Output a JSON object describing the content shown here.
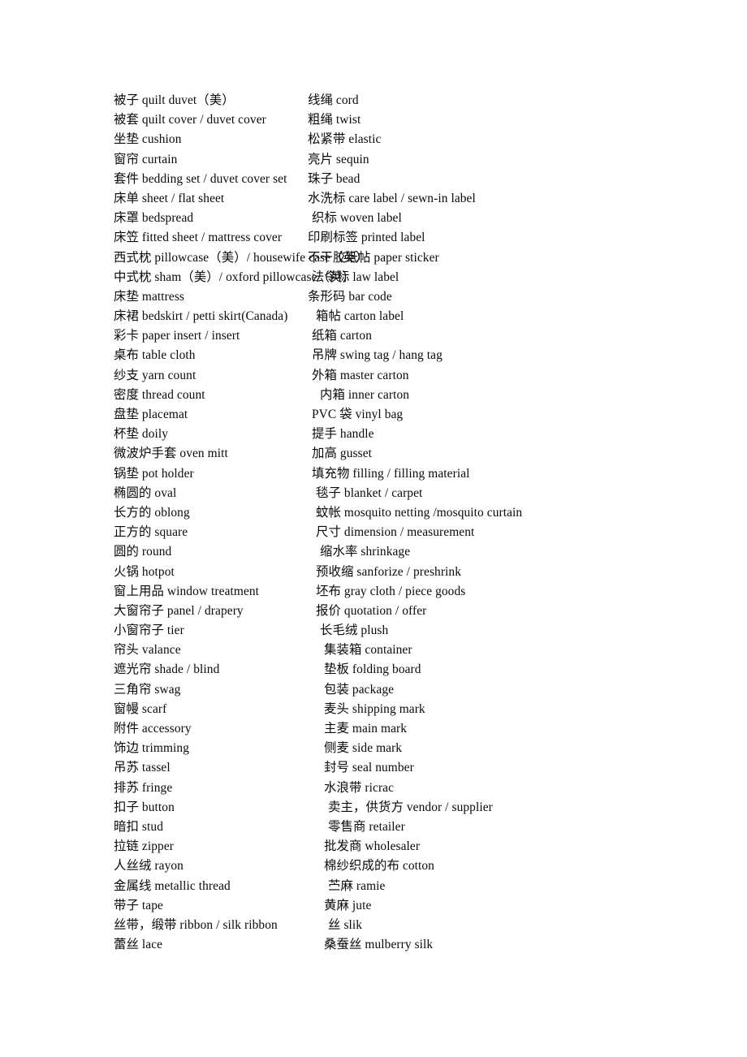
{
  "document": {
    "type": "bilingual-glossary",
    "background_color": "#ffffff",
    "text_color": "#000000"
  },
  "left_column": {
    "entries": [
      {
        "text": "被子 quilt duvet（美）",
        "indent": 0
      },
      {
        "text": "被套 quilt cover / duvet cover",
        "indent": 0
      },
      {
        "text": "坐垫  cushion",
        "indent": 0
      },
      {
        "text": "窗帘 curtain",
        "indent": 0
      },
      {
        "text": "套件 bedding set / duvet cover set",
        "indent": 0
      },
      {
        "text": "床单 sheet / flat sheet",
        "indent": 0
      },
      {
        "text": "床罩 bedspread",
        "indent": 0
      },
      {
        "text": "床笠 fitted sheet / mattress cover",
        "indent": 0
      },
      {
        "text": "西式枕 pillowcase（美）/ housewife case（英）",
        "indent": 0
      },
      {
        "text": "中式枕  sham（美）/ oxford pillowcase（英）",
        "indent": 0
      },
      {
        "text": "床垫  mattress",
        "indent": 0
      },
      {
        "text": "床裙  bedskirt / petti skirt(Canada)",
        "indent": 0
      },
      {
        "text": "彩卡 paper insert / insert",
        "indent": 0
      },
      {
        "text": "桌布 table cloth",
        "indent": 0
      },
      {
        "text": "纱支 yarn count",
        "indent": 0
      },
      {
        "text": "密度 thread count",
        "indent": 0
      },
      {
        "text": "盘垫  placemat",
        "indent": 0
      },
      {
        "text": "杯垫  doily",
        "indent": 0
      },
      {
        "text": "微波炉手套 oven mitt",
        "indent": 0
      },
      {
        "text": "锅垫  pot holder",
        "indent": 0
      },
      {
        "text": "椭圆的  oval",
        "indent": 0
      },
      {
        "text": "长方的  oblong",
        "indent": 0
      },
      {
        "text": "正方的 square",
        "indent": 0
      },
      {
        "text": "圆的 round",
        "indent": 0
      },
      {
        "text": "火锅  hotpot",
        "indent": 0
      },
      {
        "text": "窗上用品 window treatment",
        "indent": 0
      },
      {
        "text": "大窗帘子  panel / drapery",
        "indent": 0
      },
      {
        "text": "小窗帘子 tier",
        "indent": 0
      },
      {
        "text": "帘头 valance",
        "indent": 0
      },
      {
        "text": "遮光帘 shade / blind",
        "indent": 0
      },
      {
        "text": "三角帘 swag",
        "indent": 0
      },
      {
        "text": "窗幔  scarf",
        "indent": 0
      },
      {
        "text": "附件  accessory",
        "indent": 0
      },
      {
        "text": "饰边 trimming",
        "indent": 0
      },
      {
        "text": "吊苏 tassel",
        "indent": 0
      },
      {
        "text": "排苏  fringe",
        "indent": 0
      },
      {
        "text": "扣子  button",
        "indent": 0
      },
      {
        "text": "暗扣    stud",
        "indent": 0
      },
      {
        "text": "拉链  zipper",
        "indent": 0
      },
      {
        "text": "人丝绒 rayon",
        "indent": 0
      },
      {
        "text": "金属线 metallic thread",
        "indent": 0
      },
      {
        "text": "带子  tape",
        "indent": 0
      },
      {
        "text": "丝带，缎带 ribbon / silk ribbon",
        "indent": 0
      },
      {
        "text": "蕾丝 lace",
        "indent": 0
      }
    ]
  },
  "right_column": {
    "entries": [
      {
        "text": "线绳 cord",
        "indent": 0
      },
      {
        "text": "粗绳 twist",
        "indent": 0
      },
      {
        "text": "松紧带 elastic",
        "indent": 0
      },
      {
        "text": "亮片 sequin",
        "indent": 0
      },
      {
        "text": "珠子 bead",
        "indent": 0
      },
      {
        "text": "水洗标 care label / sewn-in label",
        "indent": 0
      },
      {
        "text": "织标  woven label",
        "indent": 1
      },
      {
        "text": "印刷标签 printed label",
        "indent": 0
      },
      {
        "text": "不干胶纸帖 paper sticker",
        "indent": 0
      },
      {
        "text": "法令标 law label",
        "indent": 1
      },
      {
        "text": "条形码 bar code",
        "indent": 0
      },
      {
        "text": "箱帖 carton label",
        "indent": 2
      },
      {
        "text": "纸箱 carton",
        "indent": 1
      },
      {
        "text": "吊牌 swing tag / hang tag",
        "indent": 1
      },
      {
        "text": "外箱 master carton",
        "indent": 1
      },
      {
        "text": "内箱 inner carton",
        "indent": 3
      },
      {
        "text": "PVC 袋 vinyl bag",
        "indent": 1
      },
      {
        "text": "提手 handle",
        "indent": 1
      },
      {
        "text": "加高 gusset",
        "indent": 1
      },
      {
        "text": "填充物 filling / filling material",
        "indent": 1
      },
      {
        "text": "毯子 blanket / carpet",
        "indent": 2
      },
      {
        "text": "蚊帐 mosquito netting /mosquito curtain",
        "indent": 2
      },
      {
        "text": "尺寸 dimension / measurement",
        "indent": 2
      },
      {
        "text": "缩水率 shrinkage",
        "indent": 3
      },
      {
        "text": "预收缩 sanforize / preshrink",
        "indent": 2
      },
      {
        "text": "坯布 gray cloth / piece goods",
        "indent": 2
      },
      {
        "text": "报价 quotation / offer",
        "indent": 2
      },
      {
        "text": "长毛绒 plush",
        "indent": 3
      },
      {
        "text": "集装箱 container",
        "indent": 4
      },
      {
        "text": "垫板 folding board",
        "indent": 4
      },
      {
        "text": "包装 package",
        "indent": 4
      },
      {
        "text": "麦头 shipping mark",
        "indent": 4
      },
      {
        "text": "主麦 main mark",
        "indent": 4
      },
      {
        "text": "侧麦 side mark",
        "indent": 4
      },
      {
        "text": "封号 seal number",
        "indent": 4
      },
      {
        "text": "水浪带 ricrac",
        "indent": 4
      },
      {
        "text": "卖主，供货方 vendor / supplier",
        "indent": 5
      },
      {
        "text": "零售商 retailer",
        "indent": 5
      },
      {
        "text": "批发商  wholesaler",
        "indent": 4
      },
      {
        "text": "棉纱织成的布 cotton",
        "indent": 4
      },
      {
        "text": "苎麻 ramie",
        "indent": 5
      },
      {
        "text": "黄麻 jute",
        "indent": 4
      },
      {
        "text": "丝  slik",
        "indent": 5
      },
      {
        "text": "桑蚕丝 mulberry silk",
        "indent": 4
      }
    ]
  }
}
